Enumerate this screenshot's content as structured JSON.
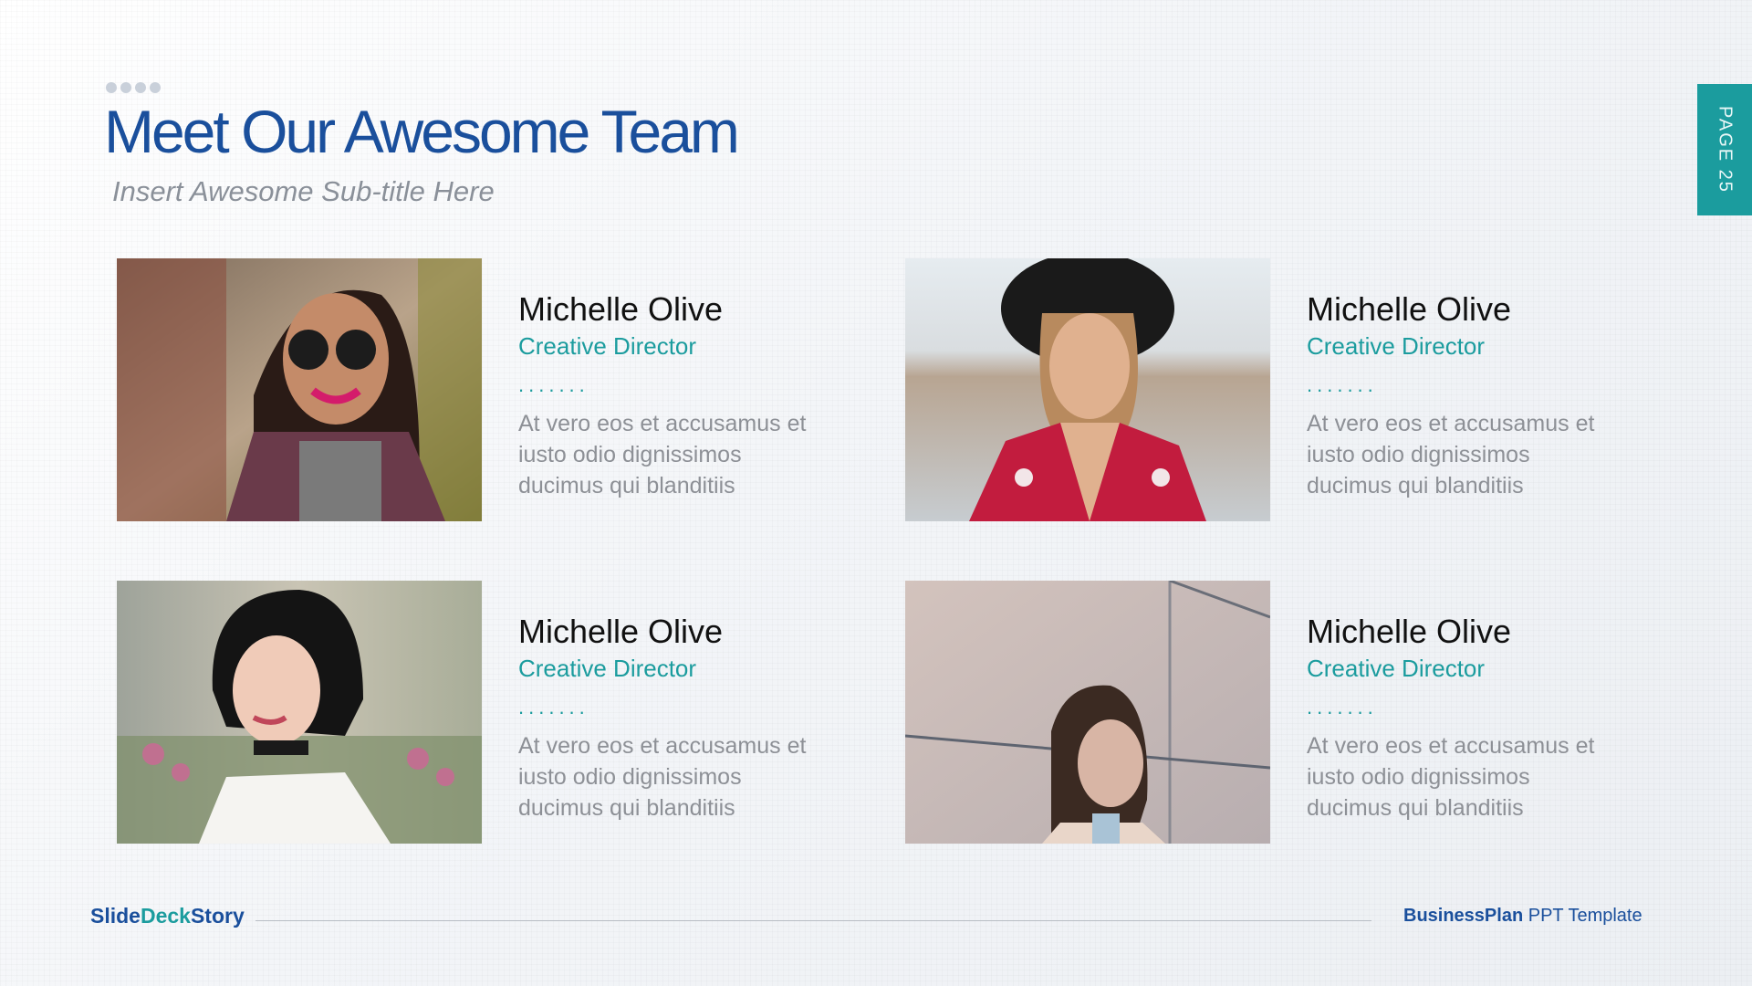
{
  "header": {
    "title": "Meet Our Awesome Team",
    "subtitle": "Insert Awesome Sub-title Here",
    "page_tab": "PAGE 25"
  },
  "team": [
    {
      "name": "Michelle Olive",
      "role": "Creative Director",
      "separator": ".......",
      "description": "At vero eos et accusamus et iusto odio dignissimos ducimus qui blanditiis",
      "photo": "woman-sunglasses-plaid-shirt"
    },
    {
      "name": "Michelle Olive",
      "role": "Creative Director",
      "separator": ".......",
      "description": "At vero eos et accusamus et iusto odio dignissimos ducimus qui blanditiis",
      "photo": "woman-black-hat-red-floral-top"
    },
    {
      "name": "Michelle Olive",
      "role": "Creative Director",
      "separator": ".......",
      "description": "At vero eos et accusamus et iusto odio dignissimos ducimus qui blanditiis",
      "photo": "woman-short-black-hair-choker"
    },
    {
      "name": "Michelle Olive",
      "role": "Creative Director",
      "separator": ".......",
      "description": "At vero eos et accusamus et iusto odio dignissimos ducimus qui blanditiis",
      "photo": "woman-bob-hair-beside-wall"
    }
  ],
  "footer": {
    "brand_part1": "Slide",
    "brand_part2": "Deck",
    "brand_part3": "Story",
    "template_bold": "BusinessPlan",
    "template_rest": " PPT Template"
  },
  "colors": {
    "title_blue": "#1a4f9c",
    "accent_teal": "#1b9c9e",
    "body_gray": "#8d9096"
  }
}
